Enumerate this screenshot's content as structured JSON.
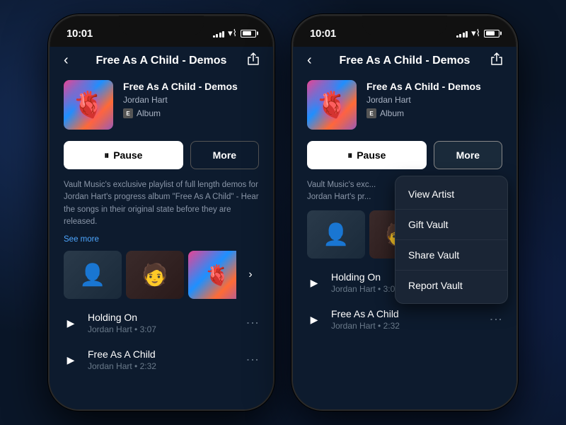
{
  "app": {
    "background_color": "#0a1628"
  },
  "phones": [
    {
      "id": "phone-left",
      "status_bar": {
        "time": "10:01"
      },
      "nav": {
        "title": "Free As A Child - Demos",
        "back_label": "‹",
        "share_label": "⎋"
      },
      "album": {
        "title": "Free As A Child - Demos",
        "artist": "Jordan Hart",
        "type": "Album",
        "type_badge": "E"
      },
      "buttons": {
        "pause_label": "Pause",
        "more_label": "More"
      },
      "description": {
        "text": "Vault Music's exclusive playlist of full length demos for Jordan Hart's progress album \"Free As A Child\" - Hear the songs in their original state before they are released.",
        "see_more": "See more"
      },
      "tracks": [
        {
          "name": "Holding On",
          "artist": "Jordan Hart",
          "duration": "3:07"
        },
        {
          "name": "Free As A Child",
          "artist": "Jordan Hart",
          "duration": "2:32"
        }
      ],
      "show_dropdown": false
    },
    {
      "id": "phone-right",
      "status_bar": {
        "time": "10:01"
      },
      "nav": {
        "title": "Free As A Child - Demos",
        "back_label": "‹",
        "share_label": "⎋"
      },
      "album": {
        "title": "Free As A Child - Demos",
        "artist": "Jordan Hart",
        "type": "Album",
        "type_badge": "E"
      },
      "buttons": {
        "pause_label": "Pause",
        "more_label": "More"
      },
      "description": {
        "text": "Vault Music's exc... Jordan Hart's pr... songs in their or...",
        "see_more": ""
      },
      "tracks": [
        {
          "name": "Holding On",
          "artist": "Jordan Hart",
          "duration": "3:07"
        },
        {
          "name": "Free As A Child",
          "artist": "Jordan Hart",
          "duration": "2:32"
        }
      ],
      "show_dropdown": true,
      "dropdown": {
        "items": [
          "View Artist",
          "Gift Vault",
          "Share Vault",
          "Report Vault"
        ]
      }
    }
  ]
}
